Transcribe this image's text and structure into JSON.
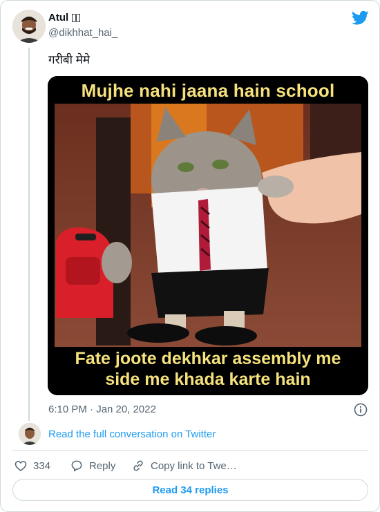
{
  "author": {
    "name": "Atul 🇮",
    "handle": "@dikhhat_hai_"
  },
  "tweet": {
    "text": "गरीबी मेमे",
    "timestamp": "6:10 PM · Jan 20, 2022"
  },
  "media": {
    "top_caption": "Mujhe nahi jaana hain school",
    "bottom_caption_line1": "Fate joote dekhkar assembly me",
    "bottom_caption_line2": "side me khada karte hain"
  },
  "links": {
    "read_conversation": "Read the full conversation on Twitter"
  },
  "actions": {
    "like_count": "334",
    "reply_label": "Reply",
    "copy_label": "Copy link to Twe…",
    "read_replies": "Read 34 replies"
  },
  "colors": {
    "accent": "#1d9bf0",
    "text_primary": "#0f1419",
    "text_secondary": "#536471",
    "border": "#cfd9de",
    "caption_yellow": "#f5e27d"
  },
  "icons": {
    "brand": "twitter-bird-icon",
    "info": "info-icon",
    "like": "heart-icon",
    "reply": "reply-bubble-icon",
    "copy": "link-icon"
  }
}
